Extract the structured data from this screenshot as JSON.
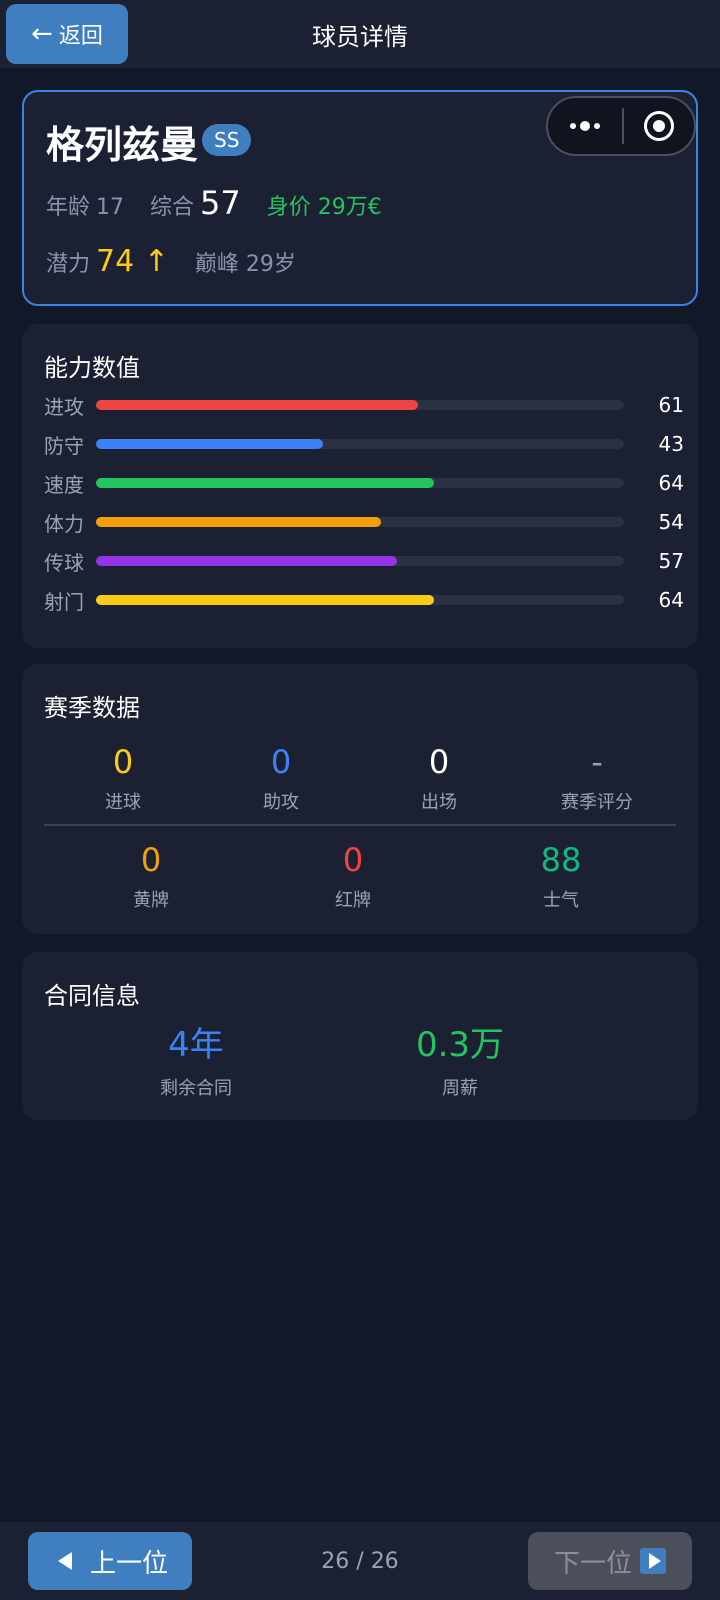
{
  "header": {
    "back_label": "返回",
    "title": "球员详情",
    "back_icon": "arrow-left-icon"
  },
  "mini_program_capsule": {
    "more_icon": "more-dots-icon",
    "close_icon": "target-circle-icon"
  },
  "player": {
    "name": "格列兹曼",
    "grade": "SS",
    "age_label": "年龄",
    "age": "17",
    "overall_label": "综合",
    "overall": "57",
    "value_text": "身价 29万€",
    "potential_label": "潜力",
    "potential": "74 ↑",
    "peak_text": "巅峰 29岁"
  },
  "abilities": {
    "title": "能力数值",
    "max": 100,
    "items": [
      {
        "label": "进攻",
        "value": "61",
        "level": 61,
        "color": "#ef4444"
      },
      {
        "label": "防守",
        "value": "43",
        "level": 43,
        "color": "#3b82f6"
      },
      {
        "label": "速度",
        "value": "64",
        "level": 64,
        "color": "#22c55e"
      },
      {
        "label": "体力",
        "value": "54",
        "level": 54,
        "color": "#f59e0b"
      },
      {
        "label": "传球",
        "value": "57",
        "level": 57,
        "color": "#9333ea"
      },
      {
        "label": "射门",
        "value": "64",
        "level": 64,
        "color": "#facc15"
      }
    ]
  },
  "season": {
    "title": "赛季数据",
    "row1": [
      {
        "value": "0",
        "label": "进球",
        "color": "#facc15"
      },
      {
        "value": "0",
        "label": "助攻",
        "color": "#3b82f6"
      },
      {
        "value": "0",
        "label": "出场",
        "color": "#ffffff"
      },
      {
        "value": "-",
        "label": "赛季评分",
        "color": "#9ca3af"
      }
    ],
    "row2": [
      {
        "value": "0",
        "label": "黄牌",
        "color": "#f59e0b"
      },
      {
        "value": "0",
        "label": "红牌",
        "color": "#ef4444"
      },
      {
        "value": "88",
        "label": "士气",
        "color": "#10b981"
      }
    ]
  },
  "contract": {
    "title": "合同信息",
    "items": [
      {
        "value": "4年",
        "label": "剩余合同",
        "color": "#3b82f6"
      },
      {
        "value": "0.3万",
        "label": "周薪",
        "color": "#22c55e"
      }
    ]
  },
  "footer": {
    "prev_label": "上一位",
    "next_label": "下一位",
    "pager": "26 / 26",
    "prev_icon": "triangle-left-icon",
    "next_icon": "triangle-right-icon"
  }
}
